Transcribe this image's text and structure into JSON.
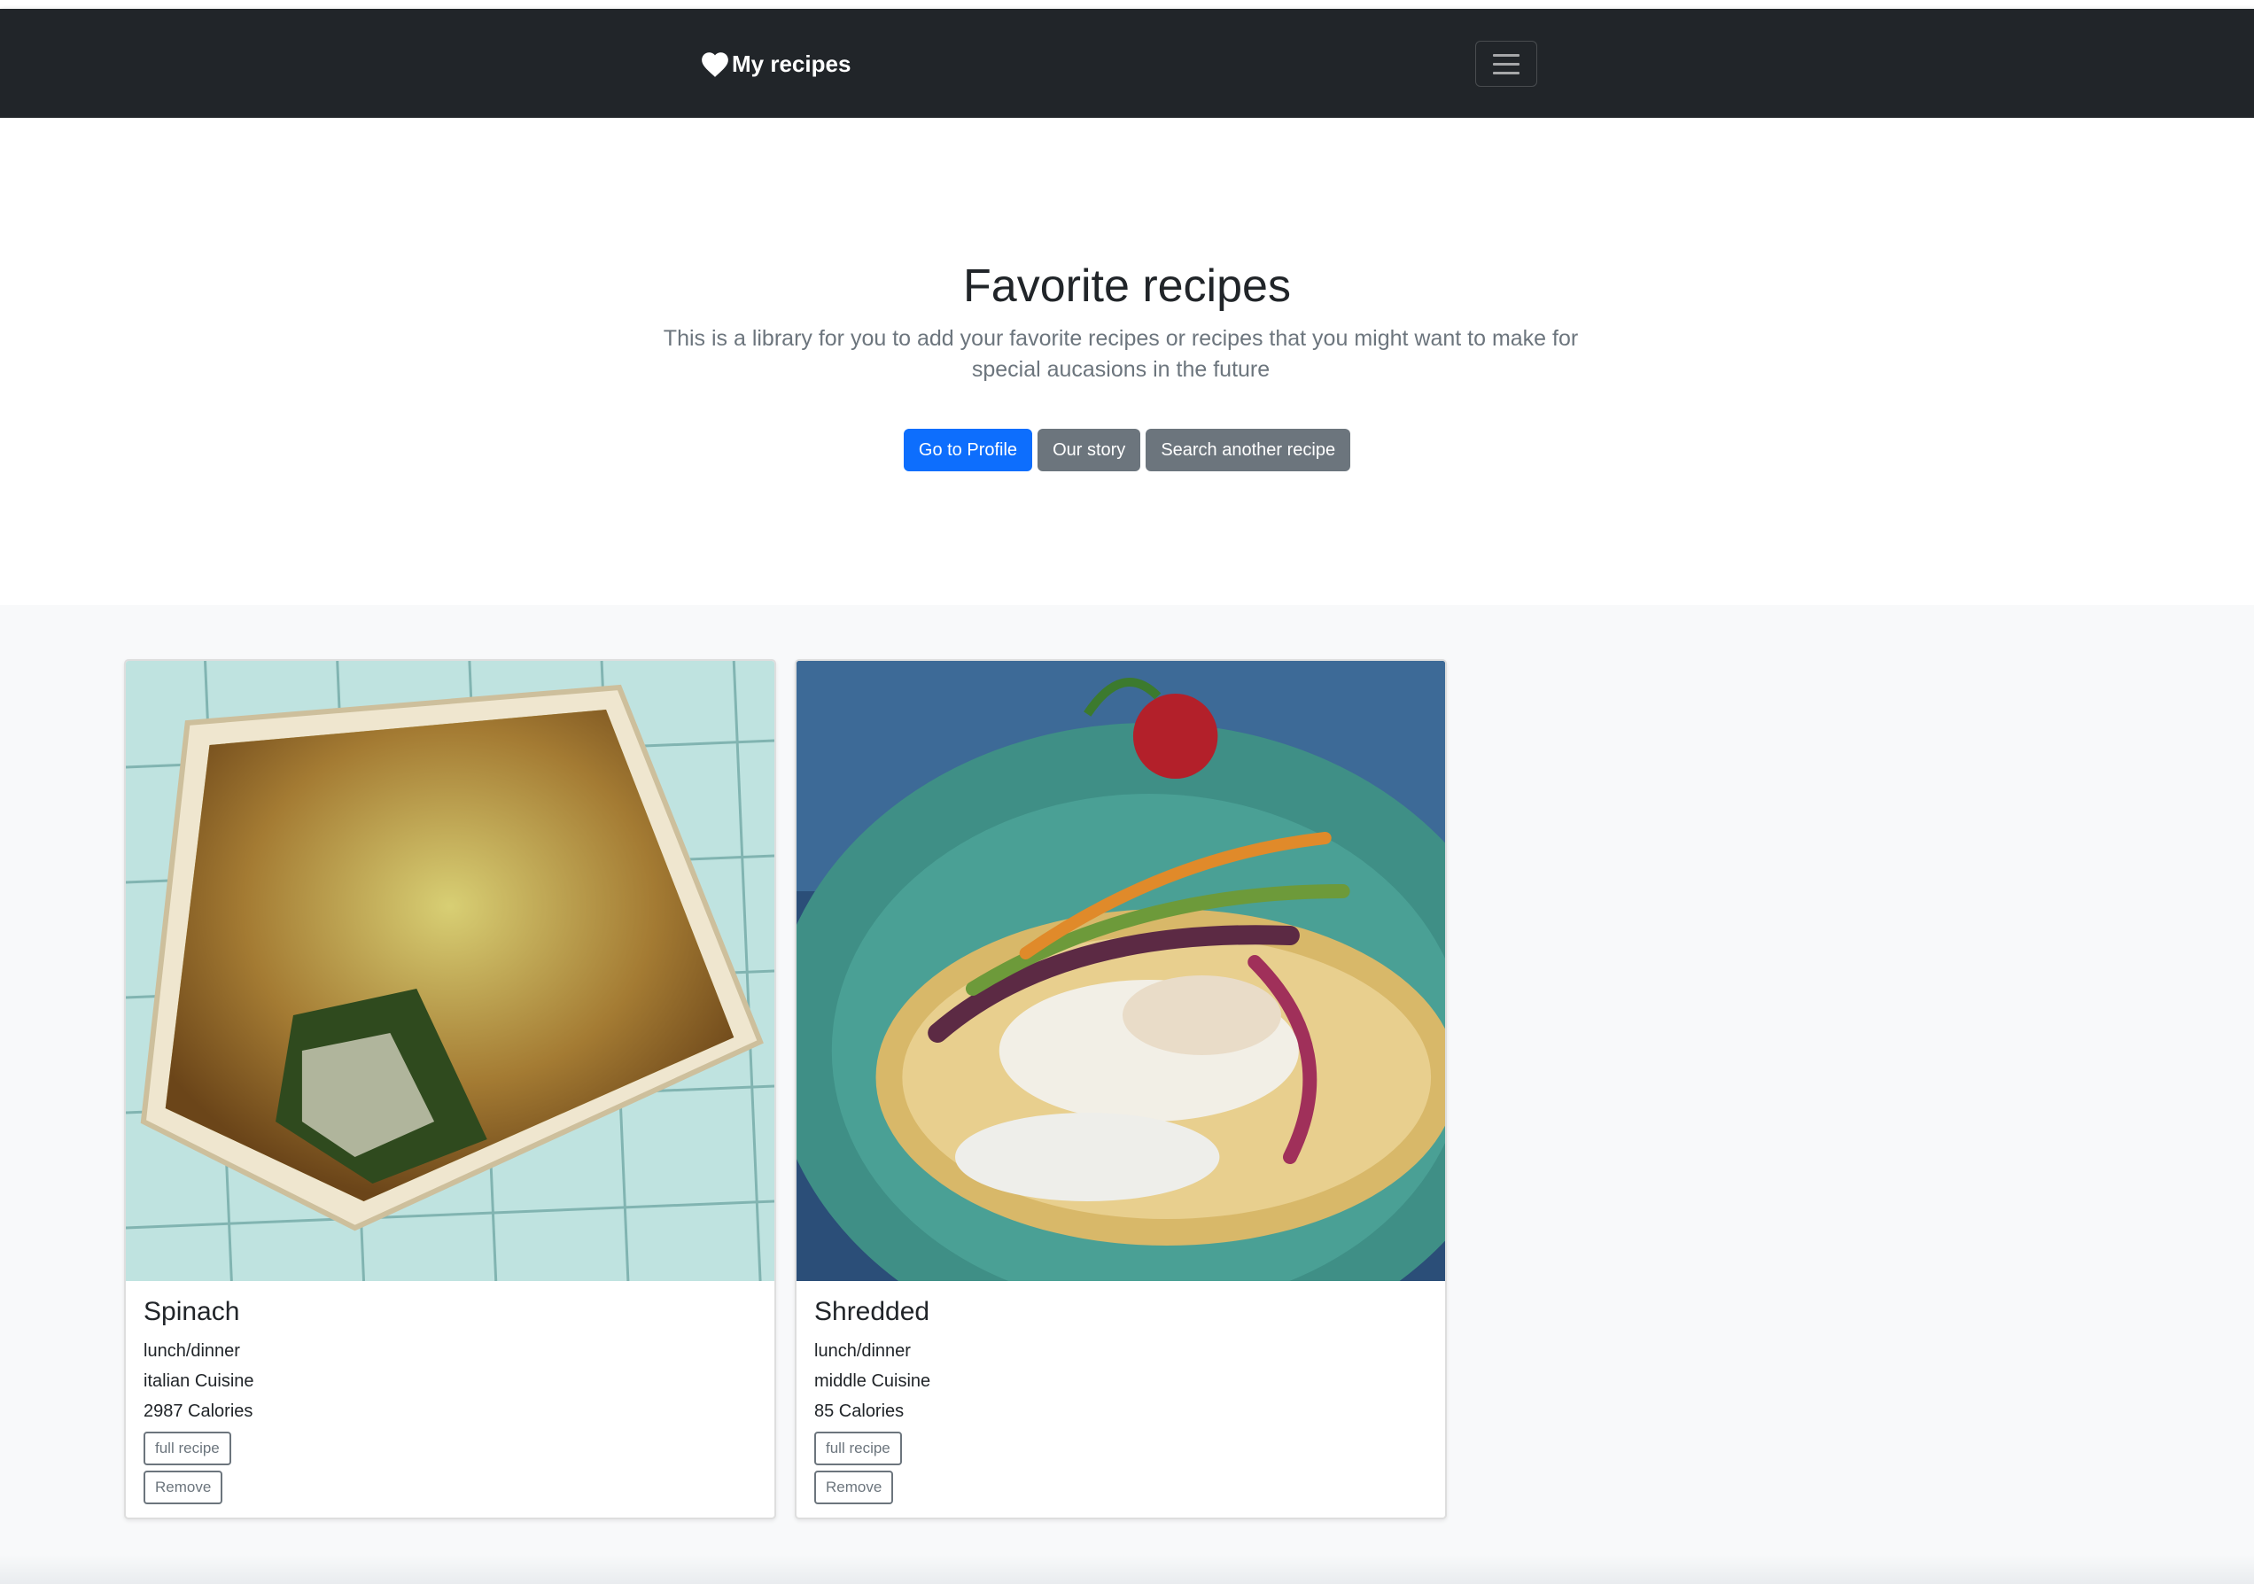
{
  "navbar": {
    "brand_label": "My recipes",
    "brand_icon": "heart-icon",
    "toggler_icon": "hamburger-icon"
  },
  "hero": {
    "title": "Favorite recipes",
    "description": "This is a library for you to add your favorite recipes or recipes that you might want to make for special aucasions in the future",
    "buttons": {
      "profile": "Go to Profile",
      "story": "Our story",
      "search": "Search another recipe"
    }
  },
  "recipes": [
    {
      "title": "Spinach",
      "meal_type": "lunch/dinner",
      "cuisine": "italian Cuisine",
      "calories": "2987 Calories",
      "full_recipe_label": "full recipe",
      "remove_label": "Remove"
    },
    {
      "title": "Shredded",
      "meal_type": "lunch/dinner",
      "cuisine": "middle Cuisine",
      "calories": "85 Calories",
      "full_recipe_label": "full recipe",
      "remove_label": "Remove"
    }
  ],
  "colors": {
    "navbar_bg": "#212529",
    "primary": "#0d6efd",
    "secondary": "#6c757d",
    "album_bg": "#f8f9fa"
  }
}
